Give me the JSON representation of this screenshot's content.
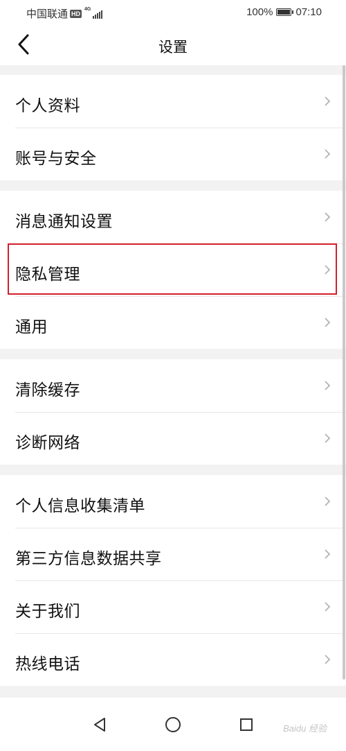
{
  "status_bar": {
    "carrier": "中国联通",
    "hd": "HD",
    "network": "4G",
    "battery": "100%",
    "time": "07:10"
  },
  "header": {
    "title": "设置",
    "back_icon": "chevron-left-icon"
  },
  "groups": [
    {
      "items": [
        {
          "label": "个人资料"
        },
        {
          "label": "账号与安全"
        }
      ]
    },
    {
      "items": [
        {
          "label": "消息通知设置"
        },
        {
          "label": "隐私管理",
          "highlighted": true
        },
        {
          "label": "通用"
        }
      ]
    },
    {
      "items": [
        {
          "label": "清除缓存"
        },
        {
          "label": "诊断网络"
        }
      ]
    },
    {
      "items": [
        {
          "label": "个人信息收集清单"
        },
        {
          "label": "第三方信息数据共享"
        },
        {
          "label": "关于我们"
        },
        {
          "label": "热线电话"
        }
      ]
    }
  ],
  "nav_bar": {
    "back_icon": "triangle-back-icon",
    "home_icon": "circle-home-icon",
    "recents_icon": "square-recents-icon"
  },
  "watermark": "Baidu 经验",
  "colors": {
    "highlight": "#d11f2c",
    "background": "#f2f2f2",
    "row_background": "#ffffff",
    "chevron": "#b3b3b3"
  }
}
